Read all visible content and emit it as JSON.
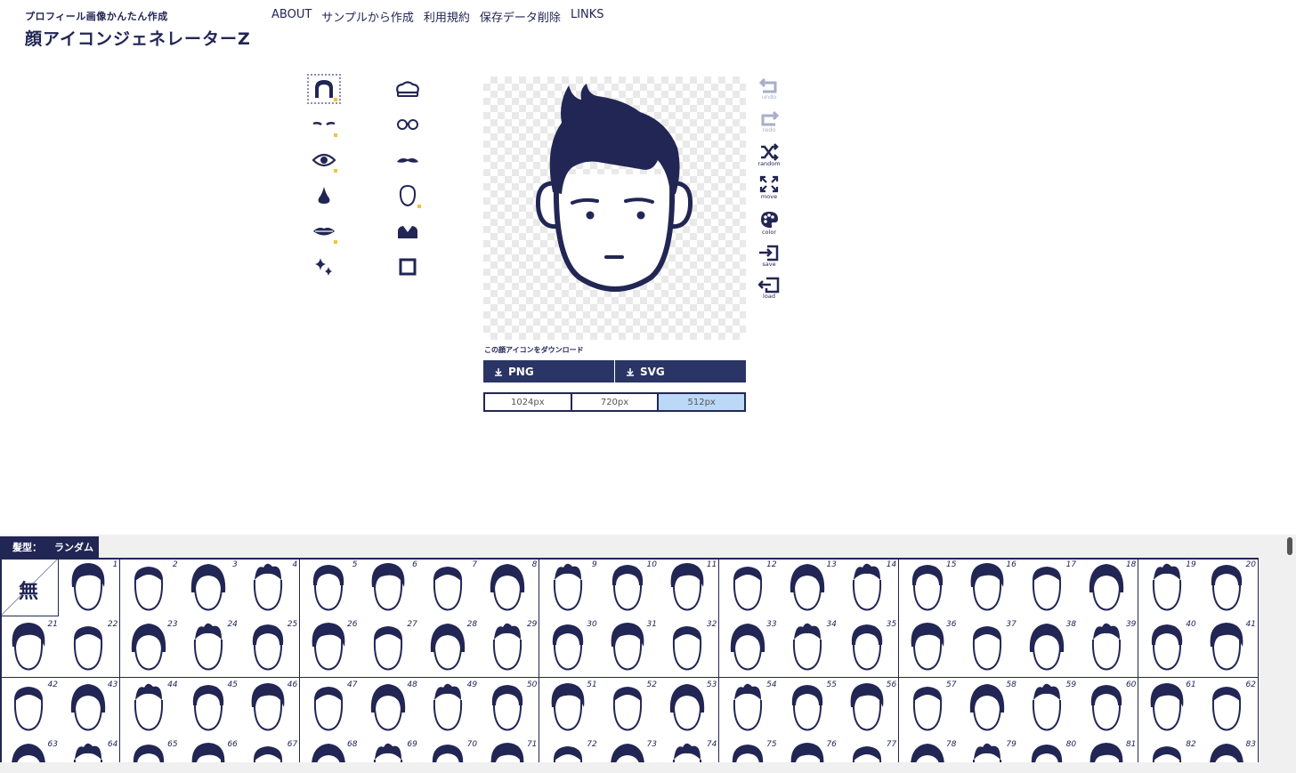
{
  "header": {
    "sub_title": "プロフィール画像かんたん作成",
    "title": "顔アイコンジェネレーターZ"
  },
  "nav": [
    "ABOUT",
    "サンプルから作成",
    "利用規約",
    "保存データ削除",
    "LINKS"
  ],
  "parts": [
    {
      "name": "hair-part-icon",
      "selected": true,
      "marked": true
    },
    {
      "name": "hat-part-icon",
      "selected": false,
      "marked": false
    },
    {
      "name": "eyebrow-part-icon",
      "selected": false,
      "marked": true
    },
    {
      "name": "glasses-part-icon",
      "selected": false,
      "marked": false
    },
    {
      "name": "eye-part-icon",
      "selected": false,
      "marked": true
    },
    {
      "name": "mustache-part-icon",
      "selected": false,
      "marked": false
    },
    {
      "name": "nose-part-icon",
      "selected": false,
      "marked": false
    },
    {
      "name": "face-outline-part-icon",
      "selected": false,
      "marked": true
    },
    {
      "name": "mouth-part-icon",
      "selected": false,
      "marked": true
    },
    {
      "name": "clothes-part-icon",
      "selected": false,
      "marked": false
    },
    {
      "name": "sparkle-part-icon",
      "selected": false,
      "marked": false
    },
    {
      "name": "frame-part-icon",
      "selected": false,
      "marked": false
    }
  ],
  "download": {
    "label": "この顔アイコンをダウンロード",
    "png": "PNG",
    "svg": "SVG",
    "sizes": [
      "1024px",
      "720px",
      "512px"
    ],
    "active_size": "512px"
  },
  "tools": [
    {
      "label": "undo",
      "icon": "undo-icon",
      "enabled": false
    },
    {
      "label": "redo",
      "icon": "redo-icon",
      "enabled": false
    },
    {
      "label": "random",
      "icon": "shuffle-icon",
      "enabled": true
    },
    {
      "label": "move",
      "icon": "move-arrows-icon",
      "enabled": true
    },
    {
      "label": "color",
      "icon": "palette-icon",
      "enabled": true
    },
    {
      "label": "save",
      "icon": "save-icon",
      "enabled": true
    },
    {
      "label": "load",
      "icon": "load-icon",
      "enabled": true
    }
  ],
  "panel": {
    "tab_label": "髪型：",
    "tab_value": "ランダム",
    "none_label": "無",
    "colors": {
      "navy": "#222654",
      "button": "#2a3565",
      "selected_size": "#bcd8f7",
      "mark": "#f0c33c"
    },
    "numbers": [
      1,
      2,
      3,
      4,
      5,
      6,
      7,
      8,
      9,
      10,
      11,
      12,
      13,
      14,
      15,
      16,
      17,
      18,
      19,
      20,
      21,
      22,
      23,
      24,
      25,
      26,
      27,
      28,
      29,
      30,
      31,
      32,
      33,
      34,
      35,
      36,
      37,
      38,
      39,
      40,
      41,
      42,
      43,
      44,
      45,
      46,
      47,
      48,
      49,
      50,
      51,
      52,
      53,
      54,
      55,
      56,
      57,
      58,
      59,
      60,
      61,
      62,
      63,
      64,
      65,
      66,
      67,
      68,
      69,
      70,
      71,
      72,
      73,
      74,
      75,
      76,
      77,
      78,
      79,
      80,
      81,
      82,
      83
    ]
  }
}
